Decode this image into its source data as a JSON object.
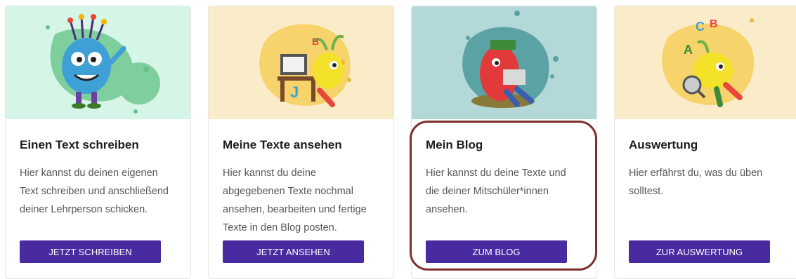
{
  "colors": {
    "card1_bg": "#d5f5e6",
    "card2_bg": "#fbecc9",
    "card3_bg": "#b3d8d8",
    "card4_bg": "#fbecc9",
    "button": "#4a2aa0",
    "highlight": "#7b2e2e"
  },
  "cards": [
    {
      "title": "Einen Text schreiben",
      "description": "Hier kannst du deinen eigenen Text schreiben und anschließend deiner Lehrperson schicken.",
      "button": "JETZT SCHREIBEN",
      "illustration": "blue-monster-with-pencils-icon"
    },
    {
      "title": "Meine Texte ansehen",
      "description": "Hier kannst du deine abgegebenen Texte nochmal ansehen, bearbeiten und fertige Texte in den Blog posten.",
      "button": "JETZT ANSEHEN",
      "illustration": "yellow-monster-at-computer-icon"
    },
    {
      "title": "Mein Blog",
      "description": "Hier kannst du deine Texte und die deiner Mitschüler*innen ansehen.",
      "button": "ZUM BLOG",
      "illustration": "red-monster-reading-icon"
    },
    {
      "title": "Auswertung",
      "description": "Hier erfährst du, was du üben solltest.",
      "button": "ZUR AUSWERTUNG",
      "illustration": "yellow-monster-with-magnifier-icon"
    }
  ]
}
